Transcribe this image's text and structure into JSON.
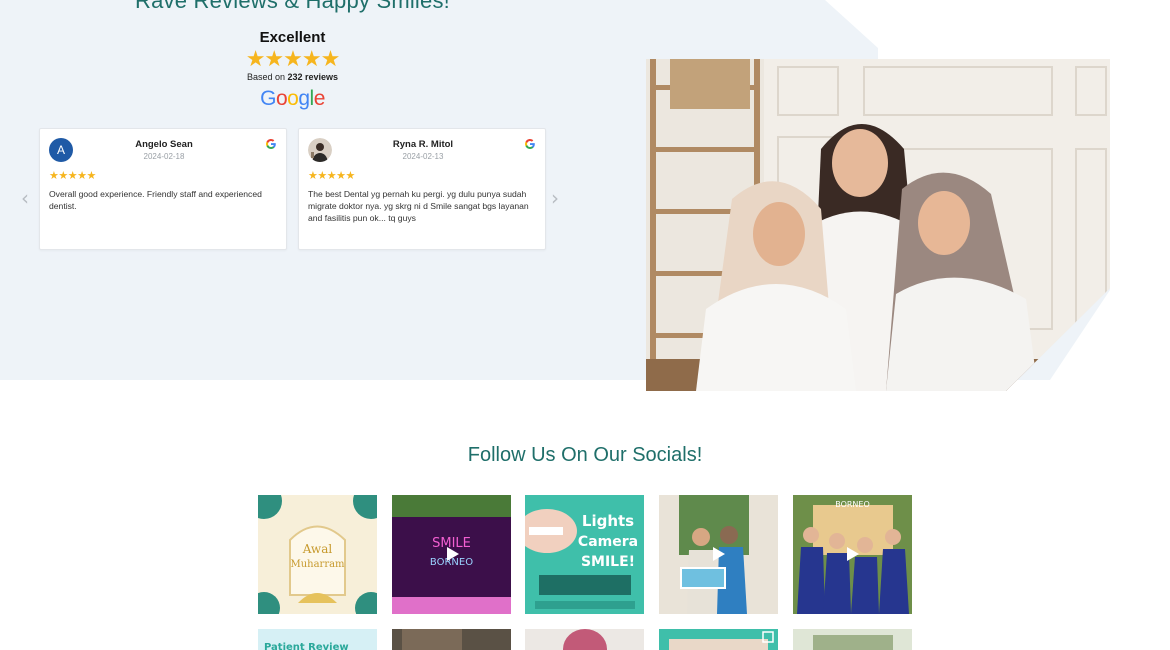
{
  "reviews": {
    "title": "Rave Reviews & Happy Smiles!",
    "rating_label": "Excellent",
    "stars": "★★★★★",
    "based_on_prefix": "Based on ",
    "review_count": "232 reviews",
    "google_logo": [
      "G",
      "o",
      "o",
      "g",
      "l",
      "e"
    ],
    "prev_arrow": "‹",
    "next_arrow": "›",
    "cards": [
      {
        "avatar_initial": "A",
        "name": "Angelo Sean",
        "date": "2024-02-18",
        "stars": "★★★★★",
        "text": "Overall good experience. Friendly staff and experienced dentist."
      },
      {
        "avatar_initial": "",
        "name": "Ryna R. Mitol",
        "date": "2024-02-13",
        "stars": "★★★★★",
        "text": "The best Dental yg pernah ku pergi. yg dulu punya sudah migrate doktor nya. yg skrg ni d Smile sangat bgs layanan and fasilitis pun ok... tq guys"
      }
    ]
  },
  "socials": {
    "title": "Follow Us On Our Socials!",
    "tiles": [
      {
        "caption_line1": "Awal",
        "caption_line2": "Muharram"
      },
      {
        "caption_line1": "SMILE",
        "caption_line2": "BORNEO"
      },
      {
        "caption_line1": "Lights",
        "caption_line2": "Camera",
        "caption_line3": "SMILE!"
      },
      {
        "caption_line1": "",
        "caption_line2": ""
      },
      {
        "caption_line1": "BORNEO",
        "caption_line2": ""
      }
    ],
    "row2_caption": "Patient Review"
  },
  "colors": {
    "accent": "#1f6f6a",
    "band": "#eef3f8",
    "star": "#f6b51e",
    "avatar_blue": "#1f5aa6"
  }
}
